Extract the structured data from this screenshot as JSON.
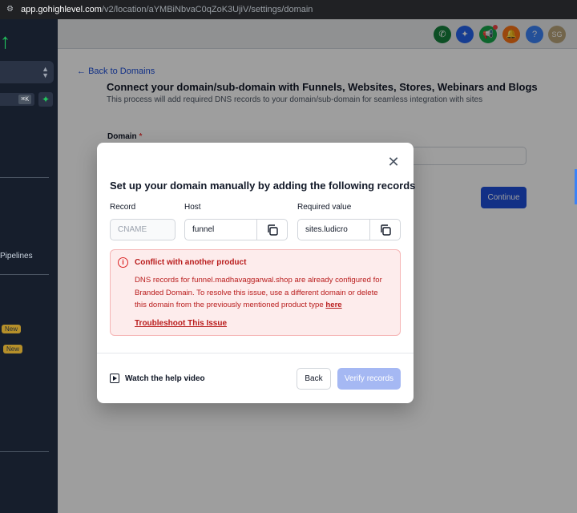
{
  "browser": {
    "url_host": "app.gohighlevel.com",
    "url_path": "/v2/location/aYMBiNbvaC0qZoK3UjiV/settings/domain"
  },
  "sidebar": {
    "shortcut": "⌘K",
    "pipelines_label": "Pipelines",
    "new_badge_1": "New",
    "new_badge_2": "New"
  },
  "header": {
    "avatar_initials": "SG",
    "help_label": "?"
  },
  "page": {
    "back_link": "Back to Domains",
    "title": "Connect your domain/sub-domain with Funnels, Websites, Stores, Webinars and Blogs",
    "subtitle": "This process will add required DNS records to your domain/sub-domain for seamless integration with sites",
    "domain_label": "Domain",
    "required_mark": "*",
    "continue_label": "Continue"
  },
  "modal": {
    "title": "Set up your domain manually by adding the following records",
    "col_record": "Record",
    "col_host": "Host",
    "col_value": "Required value",
    "record_value": "CNAME",
    "host_value": "funnel",
    "required_value": "sites.ludicro",
    "alert_title": "Conflict with another product",
    "alert_body": "DNS records for funnel.madhavaggarwal.shop are already configured for Branded Domain. To resolve this issue, use a different domain or delete this domain from the previously mentioned product type",
    "alert_here": "here",
    "alert_link": "Troubleshoot This Issue",
    "help_text": "Watch the help video",
    "back_label": "Back",
    "verify_label": "Verify records"
  },
  "colors": {
    "primary": "#1d4ed8",
    "danger": "#b91c1c",
    "sidebar": "#161e2c"
  }
}
